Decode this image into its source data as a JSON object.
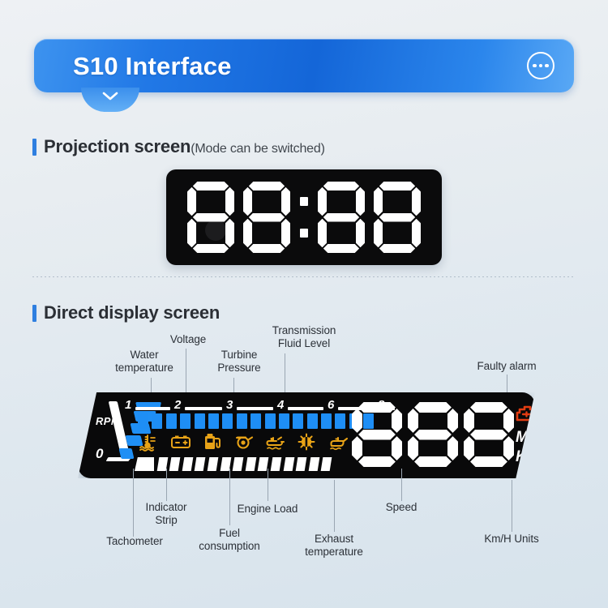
{
  "header": {
    "title": "S10 Interface",
    "more_icon": "ellipsis-icon",
    "chevron_icon": "chevron-down-icon",
    "accent_color": "#1466d8"
  },
  "sections": {
    "projection": {
      "title": "Projection screen",
      "note": "(Mode can be switched)",
      "accent_color": "#2f7fe0",
      "display": {
        "type": "seven-segment-clock",
        "digits": [
          "8",
          "8",
          "8",
          "8"
        ],
        "separator": ":",
        "value": "88:88",
        "panel_color": "#0b0b0c",
        "segment_color": "#ffffff"
      }
    },
    "direct": {
      "title": "Direct display screen",
      "accent_color": "#2f7fe0"
    }
  },
  "dashboard": {
    "rpm_label": "RPM",
    "zero_label": "0",
    "scale_numbers": [
      "1",
      "2",
      "3",
      "4",
      "6",
      "8"
    ],
    "tach_bar_count": 17,
    "tach_bar_color": "#1e8ef5",
    "arc_segment_count": 5,
    "strip_bar_count": 15,
    "strip_bar_color": "#ffffff",
    "icon_color": "#e8a317",
    "icons": [
      "water-temperature-icon",
      "battery-icon",
      "fuel-pump-icon",
      "turbine-pressure-icon",
      "transmission-fluid-icon",
      "exhaust-temperature-icon",
      "oil-can-icon"
    ],
    "speed": {
      "digits": [
        "8",
        "8",
        "8"
      ],
      "value": "888"
    },
    "units": [
      "MPH",
      "Km/H"
    ],
    "fault_icon": "check-engine-icon",
    "fault_icon_color": "#e23c12",
    "panel_color": "#09090a"
  },
  "callouts": {
    "top": [
      {
        "label": "Water\ntemperature"
      },
      {
        "label": "Voltage"
      },
      {
        "label": "Turbine\nPressure"
      },
      {
        "label": "Transmission\nFluid Level"
      },
      {
        "label": "Faulty alarm"
      }
    ],
    "bottom": [
      {
        "label": "Tachometer"
      },
      {
        "label": "Indicator\nStrip"
      },
      {
        "label": "Fuel\nconsumption"
      },
      {
        "label": "Engine Load"
      },
      {
        "label": "Exhaust\ntemperature"
      },
      {
        "label": "Speed"
      },
      {
        "label": "Km/H Units"
      }
    ]
  }
}
